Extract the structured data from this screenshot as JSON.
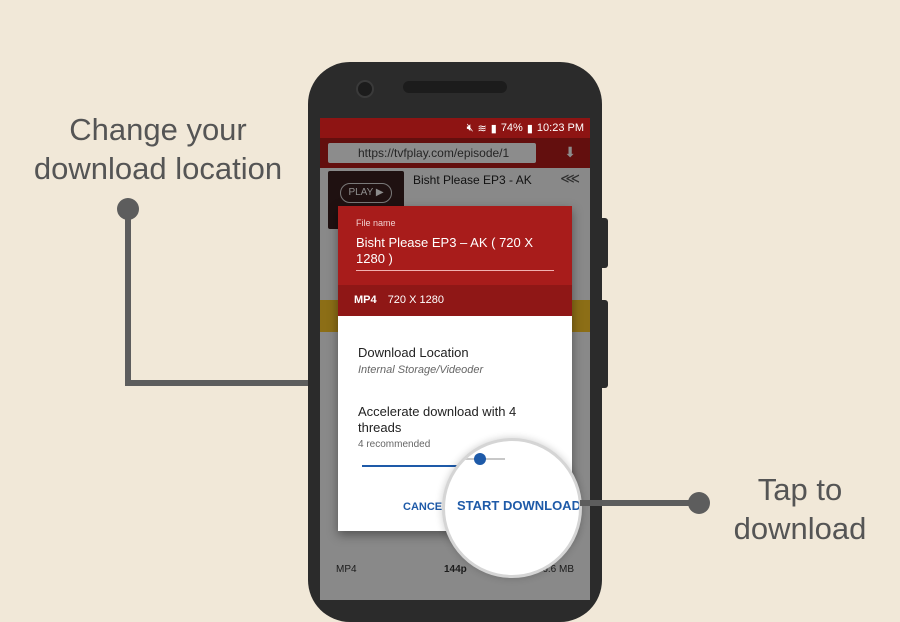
{
  "callouts": {
    "location": "Change your\ndownload location",
    "download": "Tap to\ndownload"
  },
  "status_bar": {
    "battery": "74%",
    "time": "10:23 PM"
  },
  "browser": {
    "url": "https://tvfplay.com/episode/1"
  },
  "video": {
    "title": "Bisht Please EP3 - AK",
    "play_label": "PLAY ▶"
  },
  "background_rows": [
    {
      "format": "MP4",
      "quality": "144p",
      "size": "6.6 MB"
    }
  ],
  "dialog": {
    "file_name_label": "File name",
    "file_name_value": "Bisht Please EP3 – AK ( 720 X 1280 )",
    "format_type": "MP4",
    "format_resolution": "720 X 1280",
    "download_location_label": "Download Location",
    "download_location_path": "Internal Storage/Videoder",
    "accelerate_label": "Accelerate download with 4 threads",
    "accelerate_sub": "4 recommended",
    "cancel_label": "CANCEL",
    "start_label": "START DOWNLOAD"
  },
  "icons": [
    "camera-icon",
    "download-icon",
    "share-icon",
    "play-icon",
    "battery-icon",
    "signal-icon",
    "wifi-icon"
  ],
  "colors": {
    "background": "#f1e8d8",
    "header_red": "#a81c1b",
    "dark_red": "#8f1716",
    "accent_blue": "#1e5aa8",
    "callout_gray": "#5d5d5d"
  }
}
